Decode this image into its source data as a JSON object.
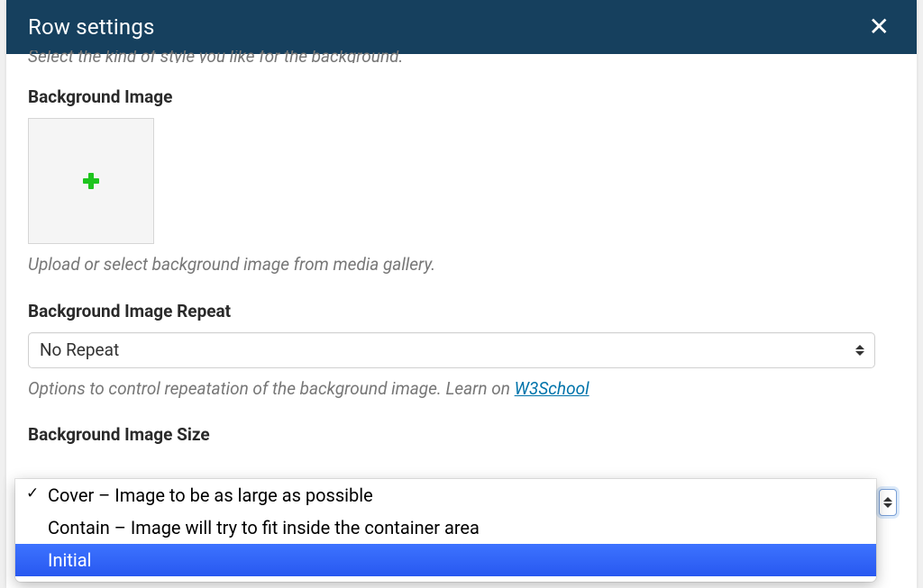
{
  "header": {
    "title": "Row settings",
    "close_aria": "Close"
  },
  "intro_truncated": "Select the kind of style you like for the background.",
  "bg_image": {
    "label": "Background Image",
    "help": "Upload or select background image from media gallery."
  },
  "bg_repeat": {
    "label": "Background Image Repeat",
    "value": "No Repeat",
    "help_pre": "Options to control repeatation of the background image. Learn on ",
    "help_link": "W3School"
  },
  "bg_size": {
    "label": "Background Image Size",
    "options": [
      {
        "label": "Cover – Image to be as large as possible",
        "checked": true,
        "highlighted": false
      },
      {
        "label": "Contain – Image will try to fit inside the container area",
        "checked": false,
        "highlighted": false
      },
      {
        "label": "Initial",
        "checked": false,
        "highlighted": true
      }
    ]
  }
}
